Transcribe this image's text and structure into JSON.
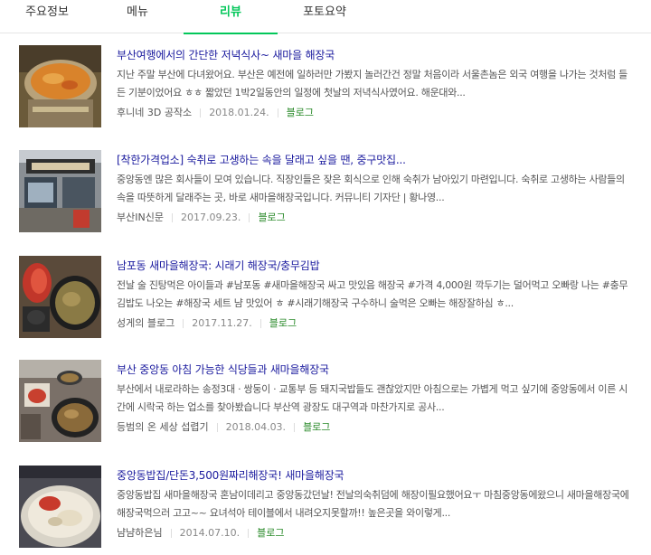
{
  "tabs": [
    {
      "label": "주요정보"
    },
    {
      "label": "메뉴"
    },
    {
      "label": "리뷰"
    },
    {
      "label": "포토요약"
    }
  ],
  "reviews": [
    {
      "title": "부산여행에서의 간단한 저녁식사~ 새마을 해장국",
      "body": "지난 주말 부산에 다녀왔어요. 부산은 예전에 일하러만 가봤지 놀러간건 정말 처음이라 서울촌놈은 외국 여행을 나가는 것처럼 들든 기분이었어요 ㅎㅎ 짧았던 1박2일동안의 일정에 첫날의 저녁식사였어요. 해운대와...",
      "author": "후니네 3D 공작소",
      "date": "2018.01.24.",
      "type": "블로그"
    },
    {
      "title": "[착한가격업소] 숙취로 고생하는 속을 달래고 싶을 땐, 중구맛집...",
      "body": "중앙동엔 많은 회사들이 모여 있습니다. 직장인들은 잦은 회식으로 인해 숙취가 남아있기 마련입니다. 숙취로 고생하는 사람들의 속을 따뜻하게 달래주는 곳, 바로 새마을해장국입니다. 커뮤니티 기자단 | 황나영...",
      "author": "부산IN신문",
      "date": "2017.09.23.",
      "type": "블로그"
    },
    {
      "title": "남포동 새마을해장국: 시래기 해장국/충무김밥",
      "body": "전날 술 진탕먹은 아이들과 #남포동 #새마을해장국 싸고 맛있음 해장국 #가격 4,000원 깍두기는 덜어먹고 오빠랑 나는 #충무김밥도 나오는 #해장국 세트 냠 맛있어 ㅎ #시래기해장국 구수하니 술먹은 오빠는 해장잘하심 ㅎ...",
      "author": "성게의 블로그",
      "date": "2017.11.27.",
      "type": "블로그"
    },
    {
      "title": "부산 중앙동 아침 가능한 식당들과 새마을해장국",
      "body": "부산에서 내로라하는 송정3대 · 쌍둥이 · 교통부 등 돼지국밥들도 괜찮았지만 아침으로는 가볍게 먹고 싶기에 중앙동에서 이른 시간에 시락국 하는 업소를 찾아봤습니다 부산역 광장도 대구역과 마찬가지로 공사...",
      "author": "등범의 온 세상 섭렵기",
      "date": "2018.04.03.",
      "type": "블로그"
    },
    {
      "title": "중앙동밥집/단돈3,500원짜리해장국! 새마을해장국",
      "body": "중앙동밥집 새마을해장국 혼남이데리고 중앙동갔던날! 전날의숙취덤에 해장이필요했어요ㅜ 마침중앙동에왔으니 새마을해장국에 해장국먹으러 고고~~ 요녀석아 테이블에서 내려오지못할까!! 높은곳을 와이렇게...",
      "author": "냠냠하은님",
      "date": "2014.07.10.",
      "type": "블로그"
    }
  ],
  "thumb_icons": [
    "hotpot-photo-icon",
    "restaurant-storefront-photo-icon",
    "soup-kimchi-photo-icon",
    "soup-table-photo-icon",
    "soup-bowl-photo-icon"
  ]
}
